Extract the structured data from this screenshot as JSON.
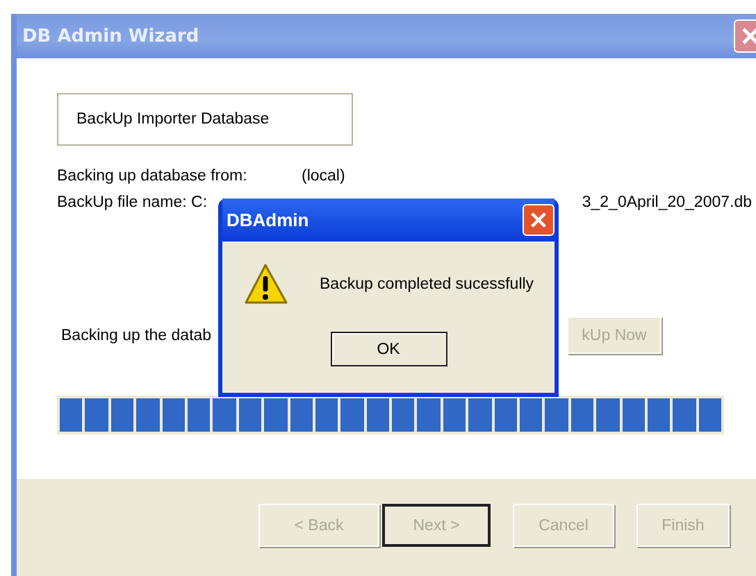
{
  "window": {
    "title": "DB Admin Wizard"
  },
  "section_title": "BackUp Importer Database",
  "source": {
    "label": "Backing up database from:",
    "value": "(local)"
  },
  "file": {
    "label": "BackUp file name:  C:",
    "value_end": "3_2_0April_20_2007.db"
  },
  "status_label": "Backing up the datab",
  "backup_button": {
    "label": "kUp Now",
    "disabled": true
  },
  "progress": {
    "level": 1
  },
  "buttons": [
    {
      "label": "< Back",
      "disabled": true,
      "default": false
    },
    {
      "label": "Next >",
      "disabled": true,
      "default": true
    },
    {
      "label": "Cancel",
      "disabled": true,
      "default": false
    },
    {
      "label": "Finish",
      "disabled": true,
      "default": false
    }
  ],
  "dialog": {
    "title": "DBAdmin",
    "message": "Backup completed sucessfully",
    "ok": "OK"
  }
}
